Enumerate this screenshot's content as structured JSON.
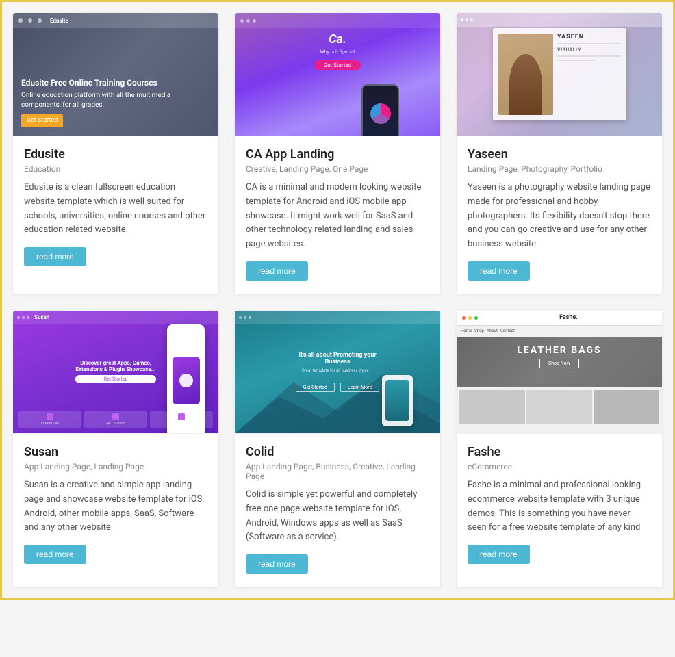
{
  "cards": [
    {
      "id": "edusite",
      "title": "Edusite",
      "categories": "Education",
      "description": "Edusite is a clean fullscreen education website template which is well suited for schools, universities, online courses and other education related website.",
      "read_more": "read more",
      "thumb_type": "edusite"
    },
    {
      "id": "ca-app-landing",
      "title": "CA App Landing",
      "categories": "Creative, Landing Page, One Page",
      "description": "CA is a minimal and modern looking website template for Android and iOS mobile app showcase. It might work well for SaaS and other technology related landing and sales page websites.",
      "read_more": "read more",
      "thumb_type": "ca"
    },
    {
      "id": "yaseen",
      "title": "Yaseen",
      "categories": "Landing Page, Photography, Portfolio",
      "description": "Yaseen is a photography website landing page made for professional and hobby photographers. Its flexibility doesn't stop there and you can go creative and use for any other business website.",
      "read_more": "read more",
      "thumb_type": "yaseen"
    },
    {
      "id": "susan",
      "title": "Susan",
      "categories": "App Landing Page, Landing Page",
      "description": "Susan is a creative and simple app landing page and showcase website template for iOS, Android, other mobile apps, SaaS, Software and any other website.",
      "read_more": "read more",
      "thumb_type": "susan"
    },
    {
      "id": "colid",
      "title": "Colid",
      "categories": "App Landing Page, Business, Creative, Landing Page",
      "description": "Colid is simple yet powerful and completely free one page website template for iOS, Android, Windows apps as well as SaaS (Software as a service).",
      "read_more": "read more",
      "thumb_type": "colid"
    },
    {
      "id": "fashe",
      "title": "Fashe",
      "categories": "eCommerce",
      "description": "Fashe is a minimal and professional looking ecommerce website template with 3 unique demos. This is something you have never seen for a free website template of any kind",
      "read_more": "read more",
      "thumb_type": "fashe"
    }
  ]
}
